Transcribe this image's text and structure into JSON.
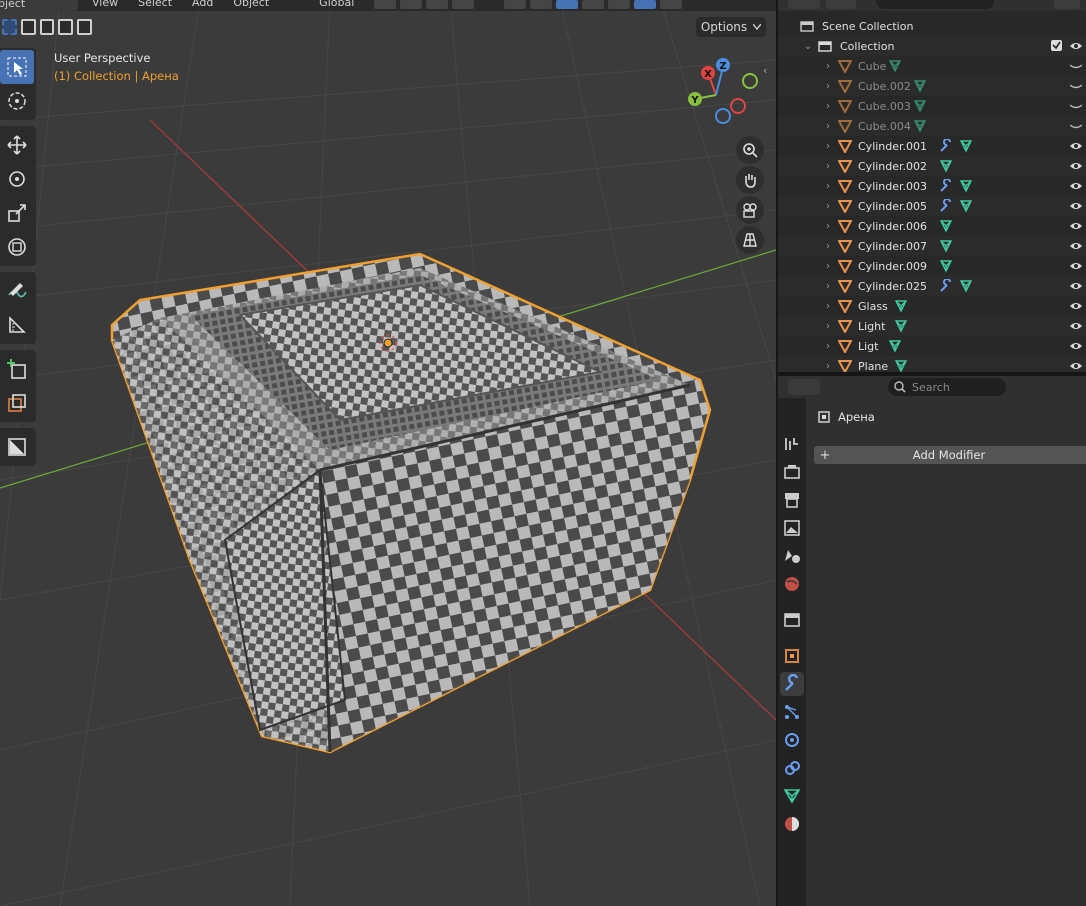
{
  "header": {
    "mode_label": "bject Mode",
    "menus": [
      "View",
      "Select",
      "Add",
      "Object"
    ],
    "orientation": "Global"
  },
  "viewport": {
    "perspective_label": "User Perspective",
    "collection_info": "(1) Collection | Арена",
    "options_label": "Options",
    "gizmo": {
      "x": "X",
      "y": "Y",
      "z": "Z"
    }
  },
  "toolbar": {
    "tools": [
      "select-box-icon",
      "cursor-icon",
      "move-icon",
      "rotate-icon",
      "scale-icon",
      "transform-icon",
      "annotate-icon",
      "measure-icon",
      "add-cube-icon",
      "extrude-icon",
      "shade-icon"
    ]
  },
  "outliner": {
    "scene_collection": "Scene Collection",
    "collection": "Collection",
    "items": [
      {
        "name": "Cube",
        "dim": true,
        "modifier": false
      },
      {
        "name": "Cube.002",
        "dim": true,
        "modifier": false
      },
      {
        "name": "Cube.003",
        "dim": true,
        "modifier": false
      },
      {
        "name": "Cube.004",
        "dim": true,
        "modifier": false
      },
      {
        "name": "Cylinder.001",
        "dim": false,
        "modifier": true
      },
      {
        "name": "Cylinder.002",
        "dim": false,
        "modifier": false
      },
      {
        "name": "Cylinder.003",
        "dim": false,
        "modifier": true
      },
      {
        "name": "Cylinder.005",
        "dim": false,
        "modifier": true
      },
      {
        "name": "Cylinder.006",
        "dim": false,
        "modifier": false
      },
      {
        "name": "Cylinder.007",
        "dim": false,
        "modifier": false
      },
      {
        "name": "Cylinder.009",
        "dim": false,
        "modifier": false
      },
      {
        "name": "Cylinder.025",
        "dim": false,
        "modifier": true
      },
      {
        "name": "Glass",
        "dim": false,
        "modifier": false
      },
      {
        "name": "Light",
        "dim": false,
        "modifier": false
      },
      {
        "name": "Ligt",
        "dim": false,
        "modifier": false
      },
      {
        "name": "Plane",
        "dim": false,
        "modifier": false
      }
    ]
  },
  "properties": {
    "search_placeholder": "Search",
    "object_name": "Арена",
    "add_modifier_label": "Add Modifier",
    "tabs": [
      "tool-icon",
      "render-icon",
      "output-icon",
      "view-layer-icon",
      "scene-icon",
      "world-icon",
      "collection-icon",
      "object-icon",
      "modifier-icon",
      "particles-icon",
      "physics-icon",
      "constraints-icon",
      "data-icon",
      "material-icon"
    ]
  },
  "colors": {
    "accent": "#4772b3",
    "selection_outline": "#f0a030",
    "x_axis": "#e04444",
    "y_axis": "#88c040",
    "z_axis": "#4a8ee0",
    "mesh_icon": "#3fc9a0",
    "modifier_icon": "#6a9ef0"
  }
}
